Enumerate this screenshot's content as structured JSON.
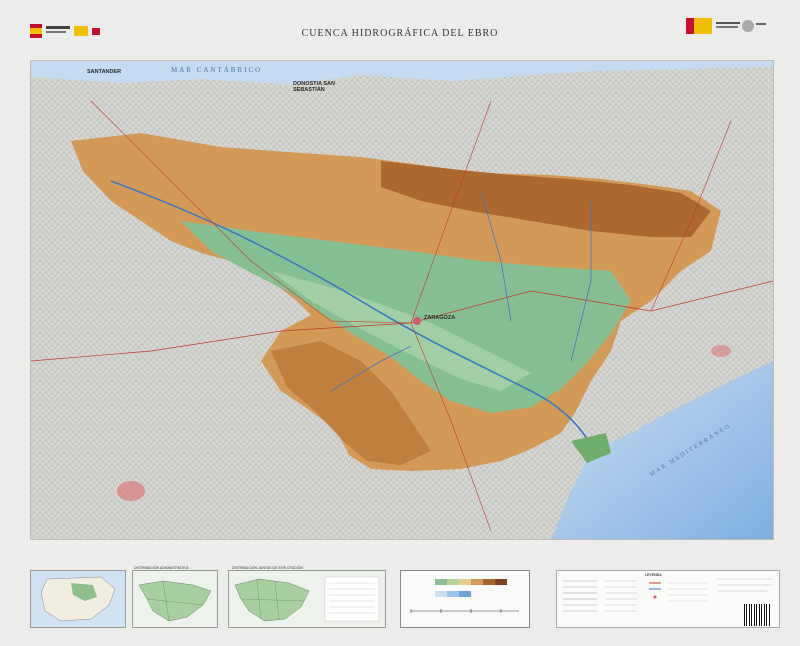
{
  "title": "CUENCA HIDROGRÁFICA DEL EBRO",
  "seas": {
    "cantabrico": "MAR CANTÁBRICO",
    "mediterraneo": "MAR MEDITERRÁNEO"
  },
  "places": {
    "santander": "SANTANDER",
    "donostia": "DONOSTIA SAN SEBASTIÁN",
    "zaragoza": "ZARAGOZA"
  },
  "insets": {
    "inset2_title": "DISTRIBUCIÓN ADMINISTRATIVA",
    "inset3_title": "DISTRIBUCIÓN JUNTAS DE EXPLOTACIÓN"
  },
  "legend": {
    "key_title": "LEYENDA"
  },
  "colors": {
    "basin_lowland": "#7fbf8f",
    "basin_mid": "#d9a45e",
    "basin_high": "#b06a2c",
    "outside": "#d8d8d4",
    "sea": "#b9d4ee",
    "sea_deep": "#8fb8e4",
    "road": "#c0392b"
  },
  "icons": {
    "logo_left": "spain-government-logo",
    "logo_right": "ministry-logo"
  }
}
